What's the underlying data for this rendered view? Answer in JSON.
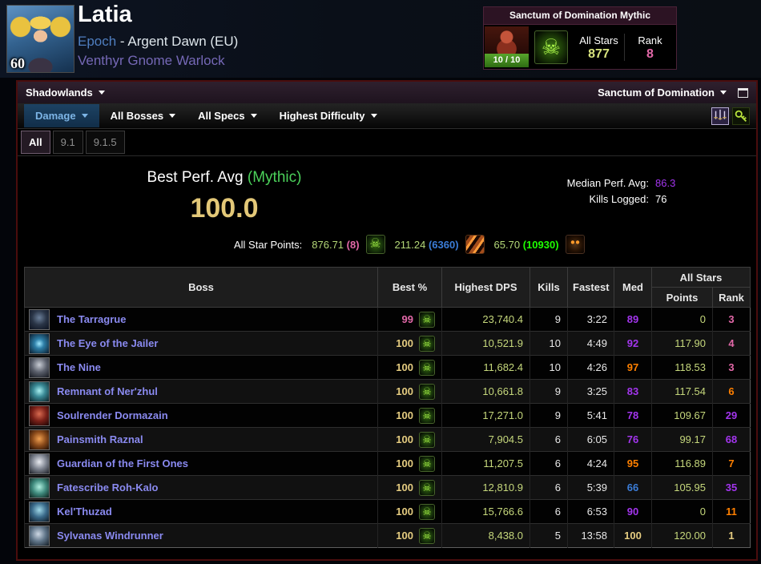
{
  "character": {
    "name": "Latia",
    "level": "60",
    "guild": "Epoch",
    "separator": " - ",
    "realm": "Argent Dawn (EU)",
    "detail": "Venthyr Gnome Warlock"
  },
  "raid_summary": {
    "title": "Sanctum of Domination Mythic",
    "progress": "10 / 10",
    "all_stars_label": "All Stars",
    "all_stars_value": "877",
    "all_stars_color": "#d8e47e",
    "rank_label": "Rank",
    "rank_value": "8",
    "rank_color": "#e268a8"
  },
  "nav": {
    "expansion_label": "Shadowlands",
    "zone_label": "Sanctum of Domination",
    "metric_label": "Damage",
    "bosses_label": "All Bosses",
    "specs_label": "All Specs",
    "difficulty_label": "Highest Difficulty"
  },
  "tabs": [
    {
      "label": "All",
      "active": true
    },
    {
      "label": "9.1",
      "active": false
    },
    {
      "label": "9.1.5",
      "active": false
    }
  ],
  "performance": {
    "best_label": "Best Perf. Avg",
    "best_difficulty": "(Mythic)",
    "best_value": "100.0",
    "median_label": "Median Perf. Avg:",
    "median_value": "86.3",
    "median_color": "#a335ee",
    "kills_label": "Kills Logged:",
    "kills_value": "76",
    "asp_label": "All Star Points:",
    "asp": [
      {
        "points": "876.71",
        "rank": "(8)",
        "rank_color": "#e268a8",
        "spec": "affliction"
      },
      {
        "points": "211.24",
        "rank": "(6360)",
        "rank_color": "#3b7dd8",
        "spec": "destruction"
      },
      {
        "points": "65.70",
        "rank": "(10930)",
        "rank_color": "#1eff00",
        "spec": "demonology"
      }
    ]
  },
  "table": {
    "headers": {
      "boss": "Boss",
      "best": "Best %",
      "dps": "Highest DPS",
      "kills": "Kills",
      "fastest": "Fastest",
      "med": "Med",
      "allstars": "All Stars",
      "points": "Points",
      "rank": "Rank"
    },
    "rows": [
      {
        "boss": "The Tarragrue",
        "best": "99",
        "best_color": "#e268a8",
        "dps": "23,740.4",
        "kills": "9",
        "fastest": "3:22",
        "med": "89",
        "med_color": "#a335ee",
        "points": "0",
        "rank": "3",
        "rank_color": "#e268a8",
        "icon_css": "background:radial-gradient(circle at 50% 40%, #6b7f99 0%, #2a3547 48%, #0d1320 100%)"
      },
      {
        "boss": "The Eye of the Jailer",
        "best": "100",
        "best_color": "#e5cc80",
        "dps": "10,521.9",
        "kills": "10",
        "fastest": "4:49",
        "med": "92",
        "med_color": "#a335ee",
        "points": "117.90",
        "rank": "4",
        "rank_color": "#e268a8",
        "icon_css": "background:radial-gradient(circle at 50% 50%, #9fe8ff 0%, #2e7fa8 35%, #0a1c2e 100%)"
      },
      {
        "boss": "The Nine",
        "best": "100",
        "best_color": "#e5cc80",
        "dps": "11,682.4",
        "kills": "10",
        "fastest": "4:26",
        "med": "97",
        "med_color": "#ff8000",
        "points": "118.53",
        "rank": "3",
        "rank_color": "#e268a8",
        "icon_css": "background:radial-gradient(circle at 50% 35%, #c8ccd4 0%, #5a5f6b 48%, #15181f 100%)"
      },
      {
        "boss": "Remnant of Ner'zhul",
        "best": "100",
        "best_color": "#e5cc80",
        "dps": "10,661.8",
        "kills": "9",
        "fastest": "3:25",
        "med": "83",
        "med_color": "#a335ee",
        "points": "117.54",
        "rank": "6",
        "rank_color": "#ff8000",
        "icon_css": "background:radial-gradient(circle at 50% 45%, #a8f0f0 0%, #3a8a96 42%, #0c2228 100%)"
      },
      {
        "boss": "Soulrender Dormazain",
        "best": "100",
        "best_color": "#e5cc80",
        "dps": "17,271.0",
        "kills": "9",
        "fastest": "5:41",
        "med": "78",
        "med_color": "#a335ee",
        "points": "109.67",
        "rank": "29",
        "rank_color": "#a335ee",
        "icon_css": "background:radial-gradient(circle at 50% 40%, #d86a50 0%, #7a2018 48%, #1a0504 100%)"
      },
      {
        "boss": "Painsmith Raznal",
        "best": "100",
        "best_color": "#e5cc80",
        "dps": "7,904.5",
        "kills": "6",
        "fastest": "6:05",
        "med": "76",
        "med_color": "#a335ee",
        "points": "99.17",
        "rank": "68",
        "rank_color": "#a335ee",
        "icon_css": "background:radial-gradient(circle at 50% 45%, #f0a050 0%, #8a4a1a 48%, #1f0d04 100%)"
      },
      {
        "boss": "Guardian of the First Ones",
        "best": "100",
        "best_color": "#e5cc80",
        "dps": "11,207.5",
        "kills": "6",
        "fastest": "4:24",
        "med": "95",
        "med_color": "#ff8000",
        "points": "116.89",
        "rank": "7",
        "rank_color": "#ff8000",
        "icon_css": "background:radial-gradient(circle at 50% 40%, #e8eaf0 0%, #7d838f 48%, #1c1f26 100%)"
      },
      {
        "boss": "Fatescribe Roh-Kalo",
        "best": "100",
        "best_color": "#e5cc80",
        "dps": "12,810.9",
        "kills": "6",
        "fastest": "5:39",
        "med": "66",
        "med_color": "#3b7dd8",
        "points": "105.95",
        "rank": "35",
        "rank_color": "#a335ee",
        "icon_css": "background:radial-gradient(circle at 50% 45%, #b0f0e0 0%, #3f8a7d 48%, #0d211c 100%)"
      },
      {
        "boss": "Kel'Thuzad",
        "best": "100",
        "best_color": "#e5cc80",
        "dps": "15,766.6",
        "kills": "6",
        "fastest": "6:53",
        "med": "90",
        "med_color": "#a335ee",
        "points": "0",
        "rank": "11",
        "rank_color": "#ff8000",
        "icon_css": "background:radial-gradient(circle at 50% 40%, #9fd8e8 0%, #3a6a8a 48%, #0e1a26 100%)"
      },
      {
        "boss": "Sylvanas Windrunner",
        "best": "100",
        "best_color": "#e5cc80",
        "dps": "8,438.0",
        "kills": "5",
        "fastest": "13:58",
        "med": "100",
        "med_color": "#e5cc80",
        "points": "120.00",
        "rank": "1",
        "rank_color": "#e5cc80",
        "icon_css": "background:radial-gradient(circle at 45% 40%, #cdd8e4 0%, #5f7488 48%, #141d26 100%)"
      }
    ]
  },
  "colors": {
    "legendary_gold": "#e5cc80",
    "astounding_pink": "#e268a8",
    "epic_purple": "#a335ee",
    "rare_blue": "#3b7dd8",
    "uncommon_green": "#1eff00",
    "dps_value": "#c6d87c",
    "boss_link": "#8a8af0",
    "mythic_green": "#4bd15a"
  }
}
